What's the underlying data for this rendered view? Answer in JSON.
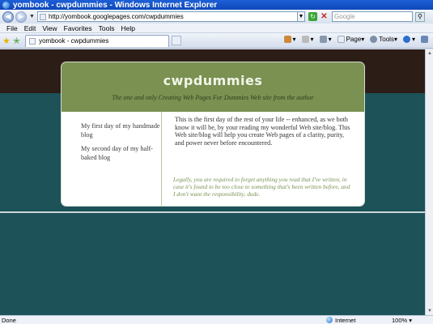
{
  "window": {
    "title": "yombook - cwpdummies - Windows Internet Explorer"
  },
  "address_bar": {
    "url": "http://yombook.googlepages.com/cwpdummies",
    "search_placeholder": "Google"
  },
  "menu": [
    "File",
    "Edit",
    "View",
    "Favorites",
    "Tools",
    "Help"
  ],
  "tab": {
    "label": "yombook - cwpdummies"
  },
  "command_bar": {
    "page_label": "Page",
    "tools_label": "Tools"
  },
  "site": {
    "title": "cwpdummies",
    "tagline": "The one and only Creating Web Pages For Dummies Web site from the author",
    "nav": [
      "My first day of my handmade blog",
      "My second day of my half-baked blog"
    ],
    "body_text": "This is the first day of the rest of your life -- enhanced, as we both know it will be, by your reading my wonderful Web site/blog. This Web site/blog will help you create Web pages of a clarity, purity, and power never before encountered.",
    "disclaimer": "Legally, you are required to forget anything you read that I've written, in case it's found to be too close to something that's been written before, and I don't want the responsibility, dude."
  },
  "status": {
    "text": "Done",
    "zone": "Internet",
    "zoom": "100%"
  },
  "colors": {
    "header_green": "#7a9152",
    "teal_bg": "#1c5258",
    "dark_band": "#2c1d17"
  }
}
